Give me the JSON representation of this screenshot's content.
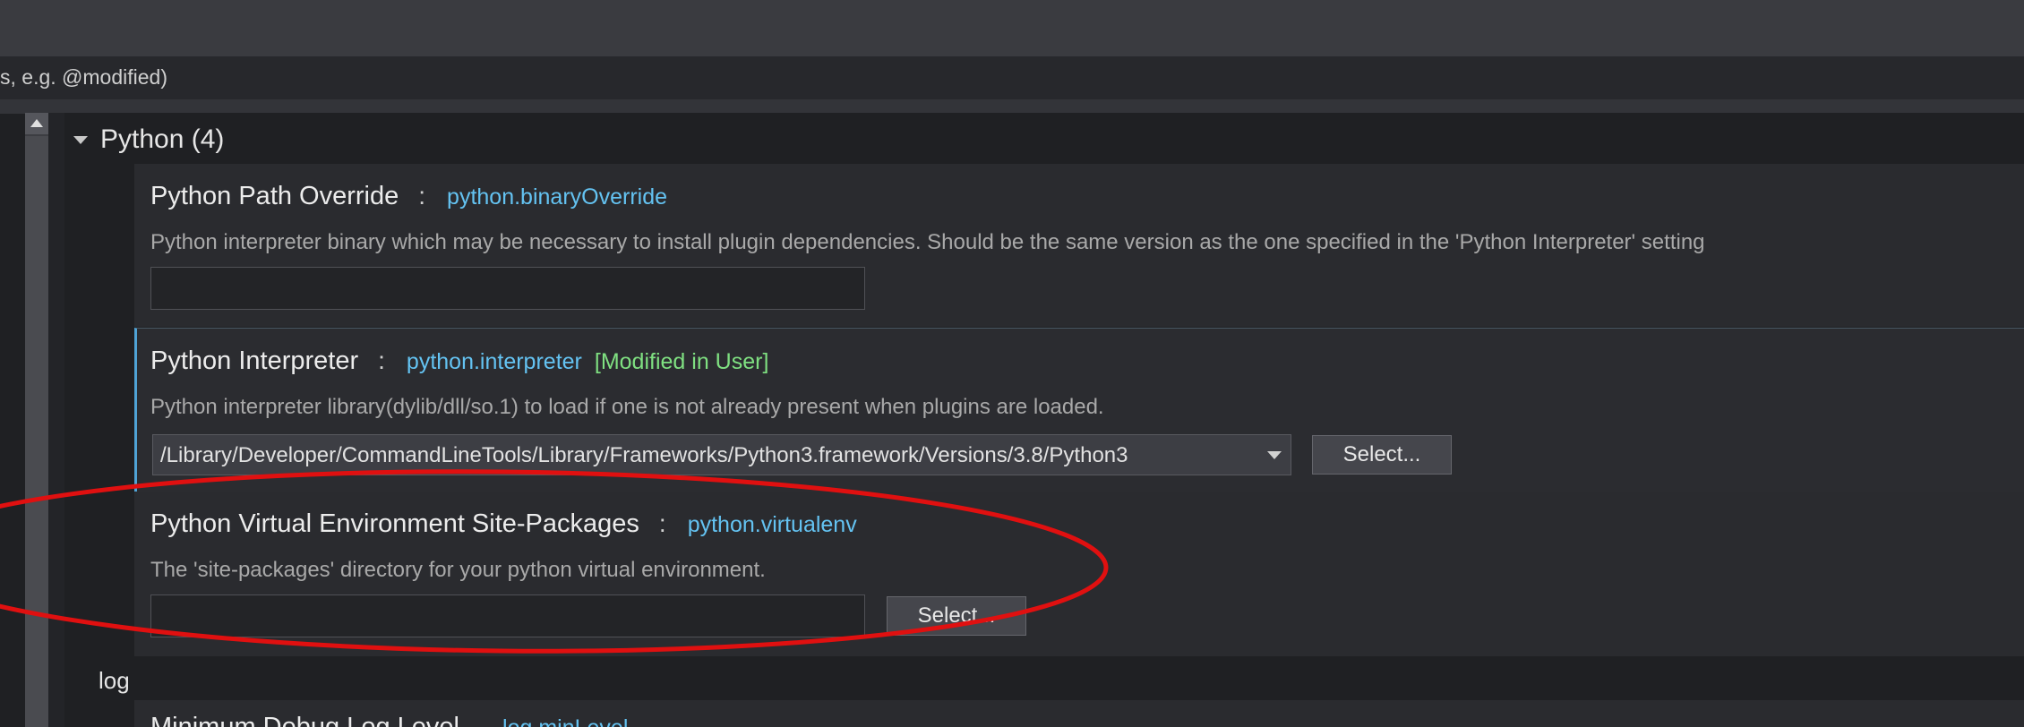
{
  "search": {
    "text": "s, e.g. @modified)"
  },
  "group": {
    "title": "Python (4)"
  },
  "settings": [
    {
      "name": "Python Path Override",
      "key": "python.binaryOverride",
      "description": "Python interpreter binary which may be necessary to install plugin dependencies. Should be the same version as the one specified in the 'Python Interpreter' setting",
      "value": ""
    },
    {
      "name": "Python Interpreter",
      "key": "python.interpreter",
      "modified": "[Modified in User]",
      "description": "Python interpreter library(dylib/dll/so.1) to load if one is not already present when plugins are loaded.",
      "value": "/Library/Developer/CommandLineTools/Library/Frameworks/Python3.framework/Versions/3.8/Python3",
      "button": "Select..."
    },
    {
      "name": "Python Virtual Environment Site-Packages",
      "key": "python.virtualenv",
      "description": "The 'site-packages' directory for your python virtual environment.",
      "value": "",
      "button": "Select..."
    }
  ],
  "log_section": {
    "label": "log"
  },
  "next_setting": {
    "name": "Minimum Debug Log Level",
    "key": "log.minLevel"
  },
  "colors": {
    "accent": "#4fa3d6",
    "key_text": "#64c3f2",
    "modified_text": "#7fe081",
    "highlight": "#e01010"
  }
}
